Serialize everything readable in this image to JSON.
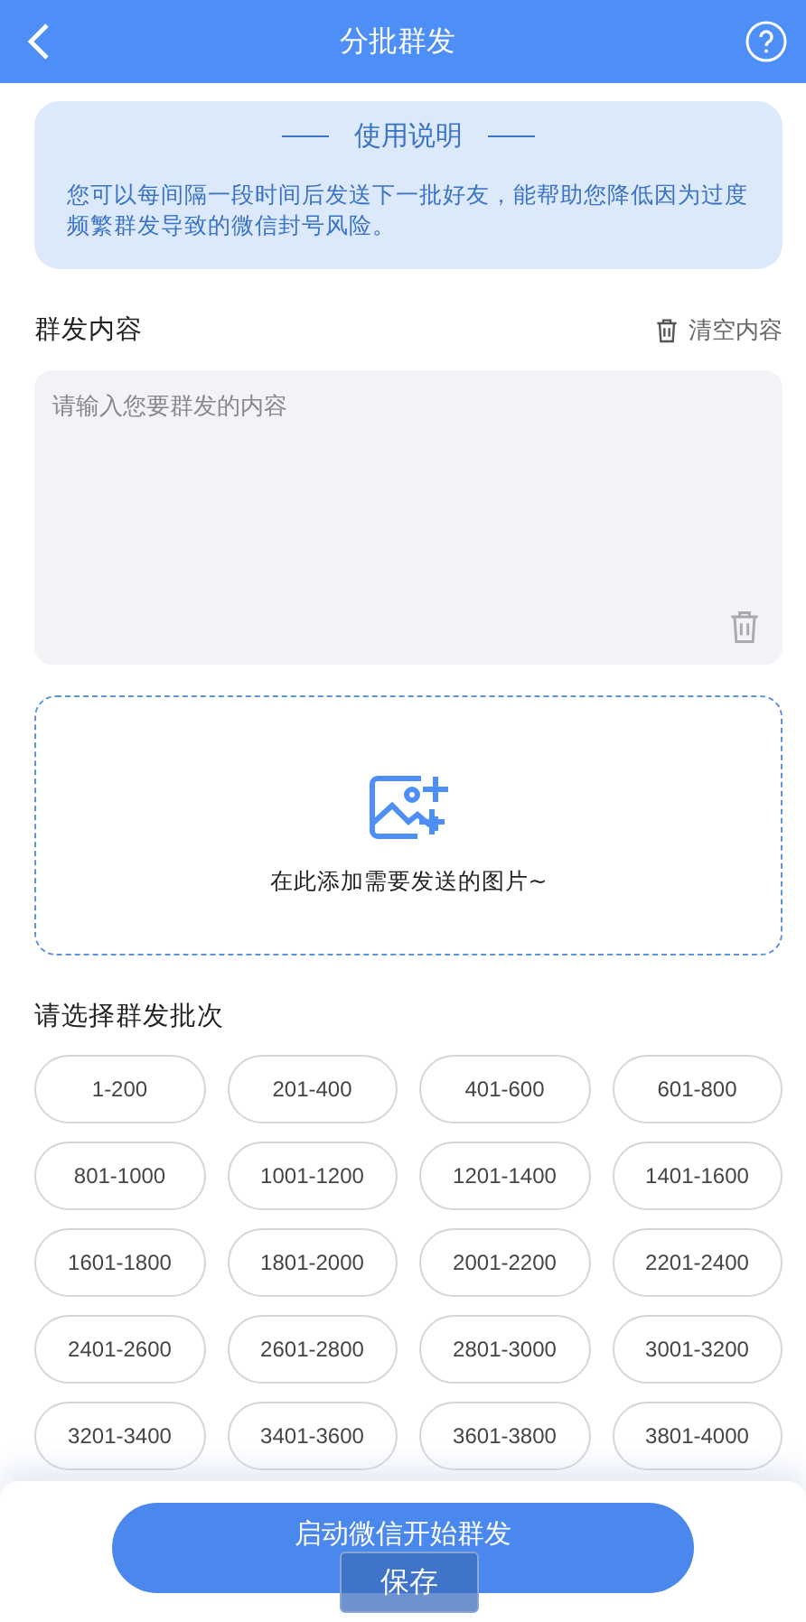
{
  "header": {
    "title": "分批群发"
  },
  "notice": {
    "title": "使用说明",
    "text": "您可以每间隔一段时间后发送下一批好友，能帮助您降低因为过度频繁群发导致的微信封号风险。"
  },
  "content": {
    "label": "群发内容",
    "clear": "清空内容",
    "placeholder": "请输入您要群发的内容"
  },
  "upload": {
    "hint": "在此添加需要发送的图片~"
  },
  "batches": {
    "label": "请选择群发批次",
    "items": [
      {
        "label": "1-200",
        "selected": false
      },
      {
        "label": "201-400",
        "selected": false
      },
      {
        "label": "401-600",
        "selected": false
      },
      {
        "label": "601-800",
        "selected": false
      },
      {
        "label": "801-1000",
        "selected": false
      },
      {
        "label": "1001-1200",
        "selected": false
      },
      {
        "label": "1201-1400",
        "selected": false
      },
      {
        "label": "1401-1600",
        "selected": false
      },
      {
        "label": "1601-1800",
        "selected": false
      },
      {
        "label": "1801-2000",
        "selected": false
      },
      {
        "label": "2001-2200",
        "selected": false
      },
      {
        "label": "2201-2400",
        "selected": false
      },
      {
        "label": "2401-2600",
        "selected": false
      },
      {
        "label": "2601-2800",
        "selected": false
      },
      {
        "label": "2801-3000",
        "selected": false
      },
      {
        "label": "3001-3200",
        "selected": false
      },
      {
        "label": "3201-3400",
        "selected": false
      },
      {
        "label": "3401-3600",
        "selected": false
      },
      {
        "label": "3601-3800",
        "selected": false
      },
      {
        "label": "3801-4000",
        "selected": false
      }
    ]
  },
  "start_button": "启动微信开始群发",
  "save_button": "保存"
}
